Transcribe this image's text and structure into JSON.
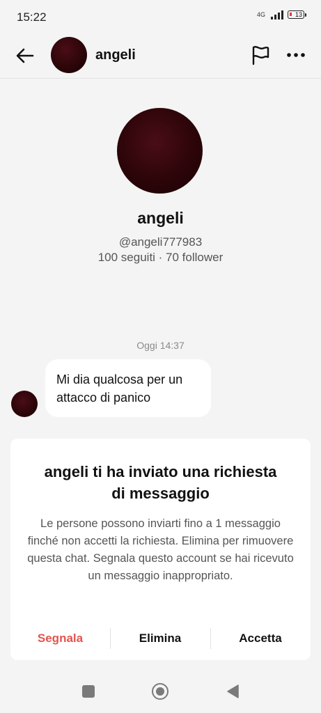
{
  "status_bar": {
    "time": "15:22",
    "network": "4G",
    "battery": "13"
  },
  "header": {
    "name": "angeli",
    "icons": [
      "back-arrow-icon",
      "flag-icon",
      "more-icon"
    ]
  },
  "profile": {
    "name": "angeli",
    "handle": "@angeli777983",
    "stats": "100 seguiti · 70 follower"
  },
  "conversation": {
    "timestamp": "Oggi 14:37",
    "messages": [
      {
        "text": "Mi dia qualcosa per un attacco di panico"
      }
    ]
  },
  "request": {
    "title": "angeli ti ha inviato una richiesta di messaggio",
    "body": "Le persone possono inviarti fino a 1 messaggio finché non accetti la richiesta. Elimina per rimuovere questa chat. Segnala questo account se hai ricevuto un messaggio inappropriato.",
    "report_label": "Segnala",
    "delete_label": "Elimina",
    "accept_label": "Accetta"
  },
  "colors": {
    "report": "#e5544f",
    "avatar": "#2a0508",
    "background": "#f4f4f4"
  }
}
